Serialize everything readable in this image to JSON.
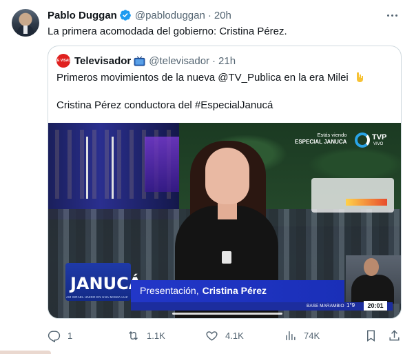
{
  "post": {
    "author_name": "Pablo Duggan",
    "handle": "@pabloduggan",
    "separator": "·",
    "time": "20h",
    "text": "La primera acomodada del gobierno: Cristina Pérez."
  },
  "quote": {
    "author_name": "Televisador",
    "handle": "@televisador",
    "separator": "·",
    "time": "21h",
    "avatar_text": "TELE VISADOR",
    "line1": "Primeros movimientos de la nueva @TV_Publica en la era Milei",
    "line2": "Cristina Pérez conductora del #EspecialJanucá"
  },
  "video": {
    "live_line1": "Estás viendo",
    "live_line2": "ESPECIAL JANUCA",
    "channel": "TVP",
    "channel_sub": "VIVO",
    "program_title": "JANUCÁ",
    "program_subtitle": "AM ISRAEL UNIDO EN UNA MISMA LUZ",
    "lower_third_label": "Presentación,",
    "lower_third_name": "Cristina Pérez",
    "base_text": "BASE MARAMBIO",
    "temperature": "1°9",
    "clock": "20:01",
    "progress": 0.5
  },
  "actions": {
    "replies": "1",
    "reposts": "1.1K",
    "likes": "4.1K",
    "views": "74K"
  },
  "icons": [
    "verified-badge-icon",
    "more-icon",
    "tv-icon",
    "pointing-down-emoji-icon",
    "reply-icon",
    "repost-icon",
    "like-icon",
    "views-icon",
    "bookmark-icon",
    "share-icon"
  ],
  "colors": {
    "verified": "#1d9bf0",
    "muted_text": "#536471",
    "border": "#cfd9de",
    "lower_third": "#2237c8",
    "brand_red": "#e0211f"
  }
}
